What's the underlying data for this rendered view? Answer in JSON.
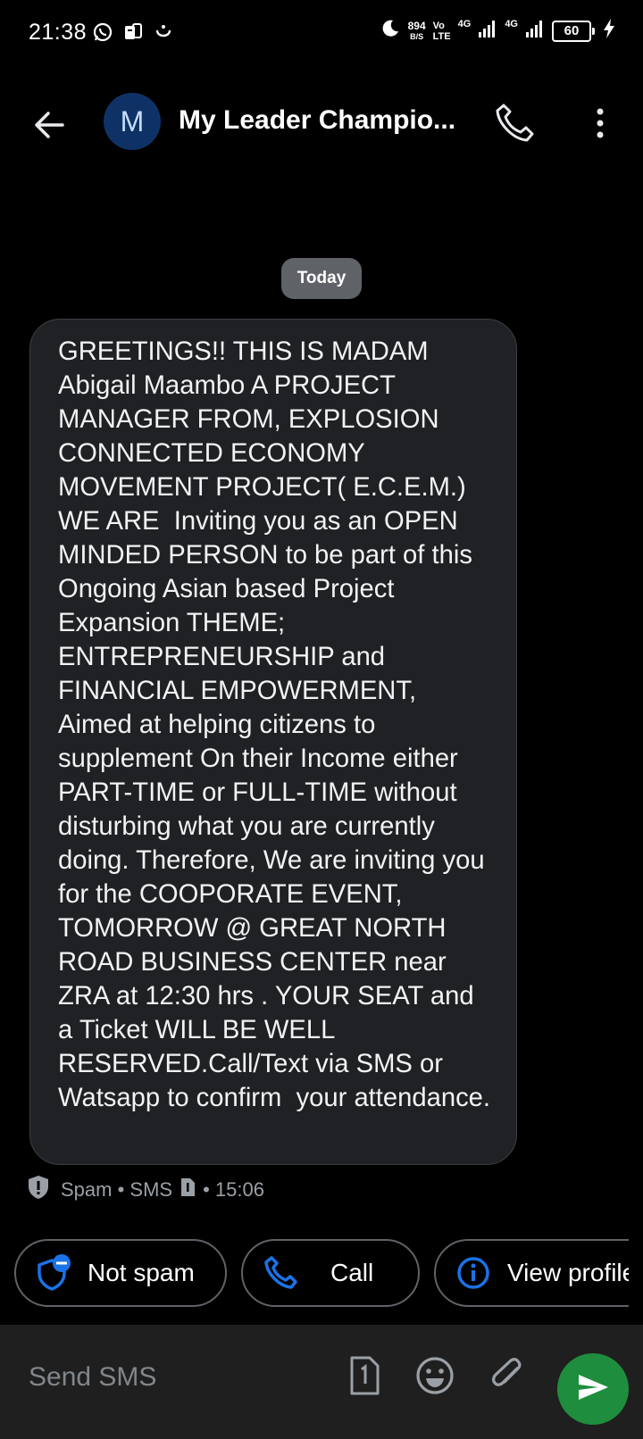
{
  "status_bar": {
    "time": "21:38",
    "net_speed_value": "894",
    "net_speed_unit": "B/S",
    "volte_top": "Vo",
    "volte_bottom": "LTE",
    "network_1": "4G",
    "network_2": "4G",
    "battery": "60"
  },
  "header": {
    "avatar_letter": "M",
    "contact_name": "My Leader Champio..."
  },
  "date_chip": "Today",
  "message": {
    "text": "GREETINGS!! THIS IS MADAM Abigail Maambo A PROJECT MANAGER FROM, EXPLOSION CONNECTED ECONOMY MOVEMENT PROJECT( E.C.E.M.) WE ARE  Inviting you as an OPEN MINDED PERSON to be part of this Ongoing Asian based Project Expansion THEME; ENTREPRENEURSHIP and FINANCIAL EMPOWERMENT, Aimed at helping citizens to supplement On their Income either PART-TIME or FULL-TIME without disturbing what you are currently doing. Therefore, We are inviting you for the COOPORATE EVENT, TOMORROW @ GREAT NORTH ROAD BUSINESS CENTER near ZRA at 12:30 hrs . YOUR SEAT and a Ticket WILL BE WELL RESERVED.Call/Text via SMS or Watsapp to confirm  your attendance.",
    "meta_label": "Spam • SMS",
    "meta_time": "• 15:06"
  },
  "chips": {
    "not_spam": "Not spam",
    "call": "Call",
    "view_profile": "View profile"
  },
  "compose": {
    "placeholder": "Send SMS"
  },
  "colors": {
    "background": "#000000",
    "bubble": "#202124",
    "accent_blue": "#1a73e8",
    "send_green": "#1e8e3e",
    "muted_text": "#9aa0a6"
  }
}
